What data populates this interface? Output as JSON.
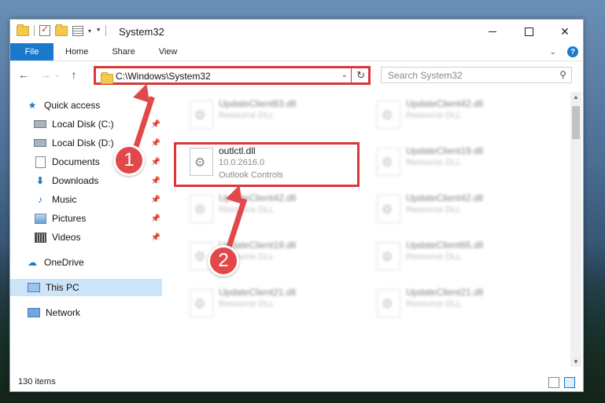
{
  "window": {
    "title": "System32"
  },
  "ribbon": {
    "file": "File",
    "tabs": [
      "Home",
      "Share",
      "View"
    ]
  },
  "address": {
    "path": "C:\\Windows\\System32"
  },
  "search": {
    "placeholder": "Search System32"
  },
  "sidebar": {
    "items": [
      {
        "label": "Quick access",
        "icon": "star-icon",
        "pinned": false
      },
      {
        "label": "Local Disk (C:)",
        "icon": "drive-icon",
        "pinned": true
      },
      {
        "label": "Local Disk (D:)",
        "icon": "drive-icon",
        "pinned": true
      },
      {
        "label": "Documents",
        "icon": "document-icon",
        "pinned": true
      },
      {
        "label": "Downloads",
        "icon": "download-icon",
        "pinned": true
      },
      {
        "label": "Music",
        "icon": "music-icon",
        "pinned": true
      },
      {
        "label": "Pictures",
        "icon": "pictures-icon",
        "pinned": true
      },
      {
        "label": "Videos",
        "icon": "videos-icon",
        "pinned": true
      },
      {
        "label": "OneDrive",
        "icon": "cloud-icon",
        "pinned": false
      },
      {
        "label": "This PC",
        "icon": "computer-icon",
        "pinned": false,
        "selected": true
      },
      {
        "label": "Network",
        "icon": "network-icon",
        "pinned": false
      }
    ]
  },
  "files": {
    "highlighted": {
      "name": "outlctl.dll",
      "version": "10.0.2616.0",
      "description": "Outlook Controls"
    },
    "left": [
      {
        "name": "UpdateClient63.dll",
        "type": "Resource DLL"
      },
      {
        "name": "UpdateClient42.dll",
        "type": "Resource DLL"
      },
      {
        "name": "UpdateClient19.dll",
        "type": "Resource DLL"
      },
      {
        "name": "UpdateClient21.dll",
        "type": "Resource DLL"
      }
    ],
    "right": [
      {
        "name": "UpdateClient42.dll",
        "type": "Resource DLL"
      },
      {
        "name": "UpdateClient19.dll",
        "type": "Resource DLL"
      },
      {
        "name": "UpdateClient42.dll",
        "type": "Resource DLL"
      },
      {
        "name": "UpdateClient65.dll",
        "type": "Resource DLL"
      },
      {
        "name": "UpdateClient21.dll",
        "type": "Resource DLL"
      }
    ]
  },
  "status": {
    "count": "130 items"
  },
  "annotations": {
    "step1": "1",
    "step2": "2",
    "color": "#e2484a"
  }
}
